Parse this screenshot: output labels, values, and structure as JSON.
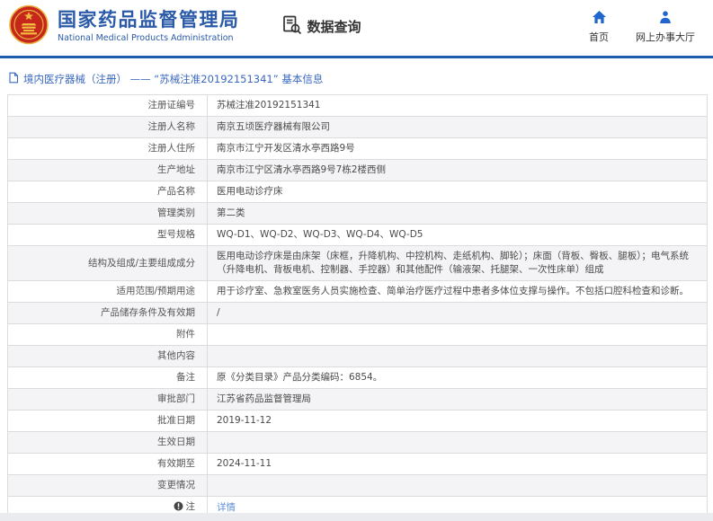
{
  "colors": {
    "accent_blue": "#2a5aa8",
    "divider_blue": "#1d5cad",
    "icon_blue": "#2166cc",
    "link_blue": "#5f8fd9",
    "stripe_gray": "#f4f4f6",
    "emblem_red": "#c6261c",
    "emblem_gold": "#f0bc3f"
  },
  "header": {
    "title": "国家药品监督管理局",
    "subtitle": "National Medical Products Administration",
    "section_label": "数据查询",
    "nav_home": "首页",
    "nav_hall": "网上办事大厅"
  },
  "breadcrumb": {
    "text": "境内医疗器械（注册） —— “苏械注准20192151341” 基本信息"
  },
  "table": {
    "rows": [
      {
        "label": "注册证编号",
        "value": "苏械注准20192151341"
      },
      {
        "label": "注册人名称",
        "value": "南京五顷医疗器械有限公司"
      },
      {
        "label": "注册人住所",
        "value": "南京市江宁开发区清水亭西路9号"
      },
      {
        "label": "生产地址",
        "value": "南京市江宁区清水亭西路9号7栋2楼西侧"
      },
      {
        "label": "产品名称",
        "value": "医用电动诊疗床"
      },
      {
        "label": "管理类别",
        "value": "第二类"
      },
      {
        "label": "型号规格",
        "value": "WQ-D1、WQ-D2、WQ-D3、WQ-D4、WQ-D5"
      },
      {
        "label": "结构及组成/主要组成成分",
        "value": "医用电动诊疗床是由床架（床框，升降机构、中控机构、走纸机构、脚轮）；床面（背板、臀板、腿板）；电气系统（升降电机、背板电机、控制器、手控器）和其他配件（输液架、托腿架、一次性床单）组成"
      },
      {
        "label": "适用范围/预期用途",
        "value": "用于诊疗室、急救室医务人员实施检查、简单治疗医疗过程中患者多体位支撑与操作。不包括口腔科检查和诊断。"
      },
      {
        "label": "产品储存条件及有效期",
        "value": "/"
      },
      {
        "label": "附件",
        "value": ""
      },
      {
        "label": "其他内容",
        "value": ""
      },
      {
        "label": "备注",
        "value": "原《分类目录》产品分类编码：6854。"
      },
      {
        "label": "审批部门",
        "value": "江苏省药品监督管理局"
      },
      {
        "label": "批准日期",
        "value": "2019-11-12"
      },
      {
        "label": "生效日期",
        "value": ""
      },
      {
        "label": "有效期至",
        "value": "2024-11-11"
      },
      {
        "label": "变更情况",
        "value": ""
      },
      {
        "label": "注",
        "value": "详情",
        "value_is_link": true,
        "label_has_icon": true
      }
    ]
  }
}
